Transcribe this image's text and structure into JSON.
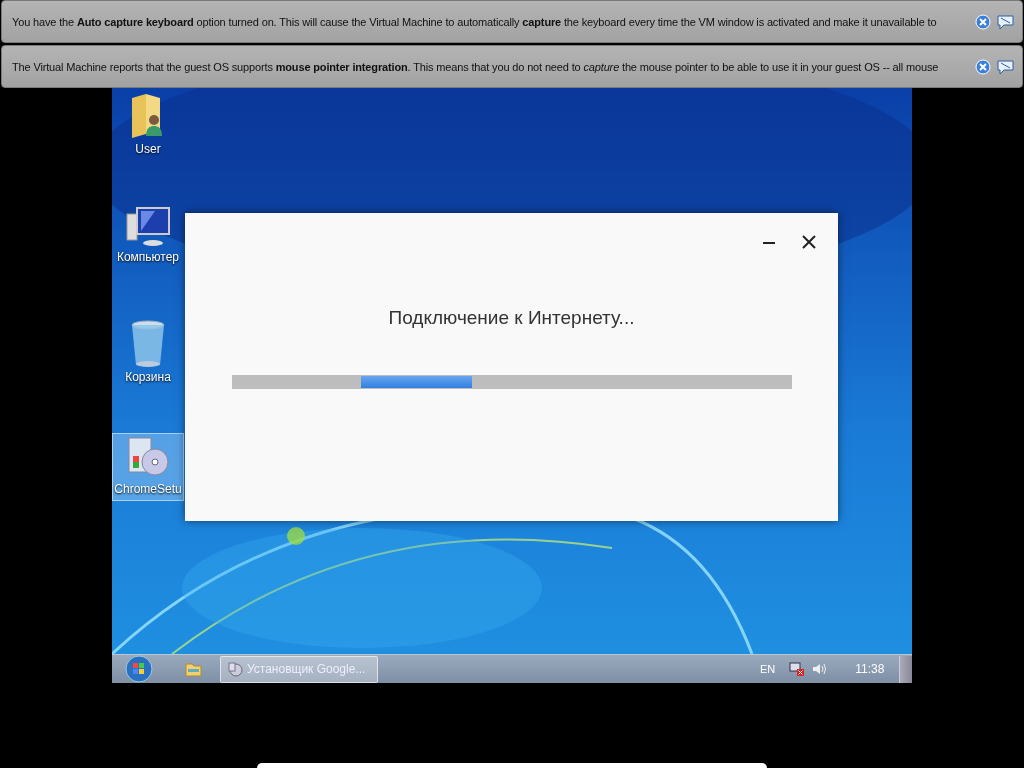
{
  "notifications": [
    {
      "text": "You have the **Auto capture keyboard** option turned on. This will cause the Virtual Machine to automatically **capture** the keyboard every time the VM window is activated and make it unavailable to"
    },
    {
      "text": "The Virtual Machine reports that the guest OS supports **mouse pointer integration**. This means that you do not need to *capture* the mouse pointer to be able to use it in your guest OS -- all mouse"
    }
  ],
  "desktop": {
    "icons": [
      {
        "kind": "user-folder",
        "label": "User",
        "selected": false
      },
      {
        "kind": "computer",
        "label": "Компьютер",
        "selected": false
      },
      {
        "kind": "recycle-bin",
        "label": "Корзина",
        "selected": false
      },
      {
        "kind": "installer",
        "label": "ChromeSetu",
        "selected": true
      }
    ]
  },
  "dialog": {
    "message": "Подключение к Интернету..."
  },
  "taskbar": {
    "tasks": [
      {
        "label": "Установщик Google...",
        "selected": true
      }
    ],
    "language": "EN",
    "clock": "11:38"
  }
}
